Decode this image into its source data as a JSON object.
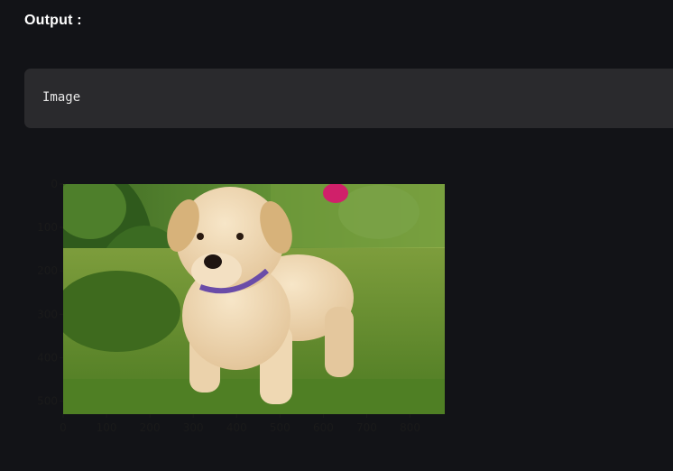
{
  "output": {
    "heading": "Output :"
  },
  "code": {
    "text": "Image"
  },
  "figure": {
    "image_subject": "puppy-photo",
    "colors": {
      "page_bg": "#121317",
      "code_bg": "#2a2a2d",
      "tick_text": "#1a1a1a"
    }
  },
  "chart_data": {
    "type": "image",
    "title": "",
    "xlabel": "",
    "ylabel": "",
    "xlim": [
      0,
      880
    ],
    "ylim": [
      530,
      0
    ],
    "xticks": [
      "0",
      "100",
      "200",
      "300",
      "400",
      "500",
      "600",
      "700",
      "800"
    ],
    "yticks": [
      "0",
      "100",
      "200",
      "300",
      "400",
      "500"
    ],
    "grid": false
  }
}
